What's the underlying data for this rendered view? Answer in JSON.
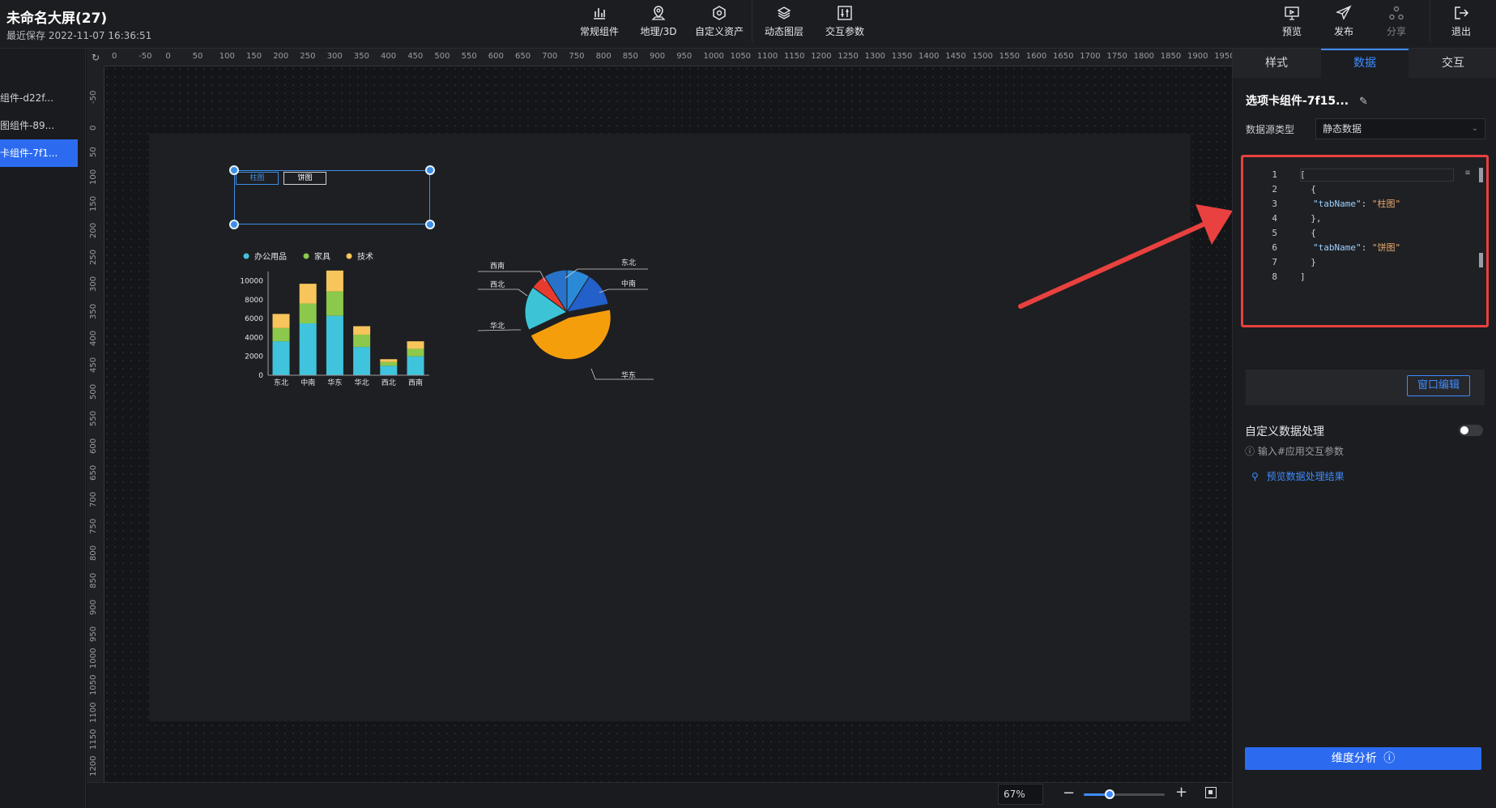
{
  "header": {
    "title": "未命名大屏(27)",
    "last_saved": "最近保存 2022-11-07 16:36:51",
    "tools": [
      {
        "label": "常规组件",
        "icon": "bar-chart-icon"
      },
      {
        "label": "地理/3D",
        "icon": "map-pin-icon"
      },
      {
        "label": "自定义资产",
        "icon": "hexagon-icon"
      },
      {
        "label": "动态图层",
        "icon": "layers-icon"
      },
      {
        "label": "交互参数",
        "icon": "sliders-icon"
      }
    ],
    "right_tools": [
      {
        "label": "预览",
        "icon": "monitor-icon"
      },
      {
        "label": "发布",
        "icon": "send-icon"
      },
      {
        "label": "分享",
        "icon": "share-icon"
      },
      {
        "label": "退出",
        "icon": "exit-icon"
      }
    ]
  },
  "layers": [
    {
      "label": "组件-d22f..."
    },
    {
      "label": "图组件-89..."
    },
    {
      "label": "卡组件-7f1..."
    }
  ],
  "ruler": {
    "top_ticks": [
      "0",
      "-50",
      "0",
      "50",
      "100",
      "150",
      "200",
      "250",
      "300",
      "350",
      "400",
      "450",
      "500",
      "550",
      "600",
      "650",
      "700",
      "750",
      "800",
      "850",
      "900",
      "950",
      "1000",
      "1050",
      "1100",
      "1150",
      "1200",
      "1250",
      "1300",
      "1350",
      "1400",
      "1450",
      "1500",
      "1550",
      "1600",
      "1650",
      "1700",
      "1750",
      "1800",
      "1850",
      "1900",
      "1950"
    ],
    "left_ticks": [
      "-50",
      "0",
      "50",
      "100",
      "150",
      "200",
      "250",
      "300",
      "350",
      "400",
      "450",
      "500",
      "550",
      "600",
      "650",
      "700",
      "750",
      "800",
      "850",
      "900",
      "950",
      "1000",
      "1050",
      "1100",
      "1150",
      "1200"
    ]
  },
  "canvas": {
    "tabs": [
      {
        "label": "柱图"
      },
      {
        "label": "饼图"
      }
    ],
    "zoom": "67%",
    "zoom_fraction": 0.32
  },
  "chart_data": [
    {
      "type": "bar",
      "stacked": true,
      "categories": [
        "东北",
        "中南",
        "华东",
        "华北",
        "西北",
        "西南"
      ],
      "series": [
        {
          "name": "办公用品",
          "values": [
            3600,
            5500,
            6300,
            3000,
            1000,
            2000
          ],
          "color": "#40c3dd"
        },
        {
          "name": "家具",
          "values": [
            1400,
            2100,
            2600,
            1300,
            400,
            800
          ],
          "color": "#8cc84b"
        },
        {
          "name": "技术",
          "values": [
            1500,
            2100,
            2200,
            900,
            300,
            800
          ],
          "color": "#f7c55b"
        }
      ],
      "yticks": [
        "10000",
        "8000",
        "6000",
        "4000",
        "2000",
        "0"
      ],
      "ylim": [
        0,
        11000
      ],
      "legend": "top-left"
    },
    {
      "type": "pie",
      "slices": [
        {
          "label": "东北",
          "value": 9,
          "color": "#2b8ad8"
        },
        {
          "label": "中南",
          "value": 13,
          "color": "#2460c9"
        },
        {
          "label": "华东",
          "value": 46,
          "color": "#f59e0c"
        },
        {
          "label": "华北",
          "value": 17,
          "color": "#3cc4d6"
        },
        {
          "label": "西北",
          "value": 6,
          "color": "#e63b2e"
        },
        {
          "label": "西南",
          "value": 9,
          "color": "#2873c9"
        }
      ]
    }
  ],
  "right_panel": {
    "tabs": [
      {
        "label": "样式"
      },
      {
        "label": "数据"
      },
      {
        "label": "交互"
      }
    ],
    "component_name": "选项卡组件-7f15...",
    "datasource_label": "数据源类型",
    "datasource_value": "静态数据",
    "code_lines": [
      {
        "n": "1",
        "text": "["
      },
      {
        "n": "2",
        "text": "  {"
      },
      {
        "n": "3",
        "key": "\"tabName\"",
        "val": "\"柱图\""
      },
      {
        "n": "4",
        "text": "  },"
      },
      {
        "n": "5",
        "text": "  {"
      },
      {
        "n": "6",
        "key": "\"tabName\"",
        "val": "\"饼图\""
      },
      {
        "n": "7",
        "text": "  }"
      },
      {
        "n": "8",
        "text": "]"
      }
    ],
    "window_edit": "窗口编辑",
    "custom_processing": "自定义数据处理",
    "hint": "输入#应用交互参数",
    "preview_result": "预览数据处理结果",
    "dimension_button": "维度分析"
  }
}
